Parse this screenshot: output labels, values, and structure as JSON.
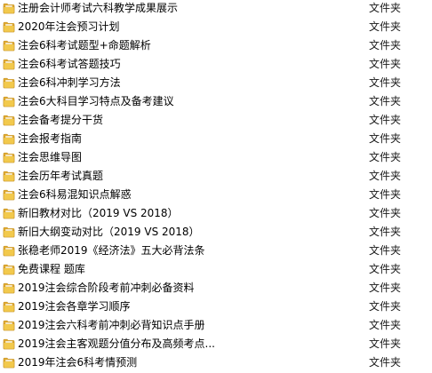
{
  "file_list": {
    "type_label": "文件夹",
    "items": [
      {
        "name": "注册会计师考试六科教学成果展示",
        "type": "文件夹"
      },
      {
        "name": "2020年注会预习计划",
        "type": "文件夹"
      },
      {
        "name": "注会6科考试题型+命题解析",
        "type": "文件夹"
      },
      {
        "name": "注会6科考试答题技巧",
        "type": "文件夹"
      },
      {
        "name": "注会6科冲刺学习方法",
        "type": "文件夹"
      },
      {
        "name": "注会6大科目学习特点及备考建议",
        "type": "文件夹"
      },
      {
        "name": "注会备考提分干货",
        "type": "文件夹"
      },
      {
        "name": "注会报考指南",
        "type": "文件夹"
      },
      {
        "name": "注会思维导图",
        "type": "文件夹"
      },
      {
        "name": "注会历年考试真题",
        "type": "文件夹"
      },
      {
        "name": "注会6科易混知识点解惑",
        "type": "文件夹"
      },
      {
        "name": "新旧教材对比（2019 VS 2018）",
        "type": "文件夹"
      },
      {
        "name": "新旧大纲变动对比（2019 VS 2018）",
        "type": "文件夹"
      },
      {
        "name": "张稳老师2019《经济法》五大必背法条",
        "type": "文件夹"
      },
      {
        "name": "免费课程 题库",
        "type": "文件夹"
      },
      {
        "name": "2019注会综合阶段考前冲刺必备资料",
        "type": "文件夹"
      },
      {
        "name": "2019注会各章学习顺序",
        "type": "文件夹"
      },
      {
        "name": "2019注会六科考前冲刺必背知识点手册",
        "type": "文件夹"
      },
      {
        "name": "2019注会主客观题分值分布及高频考点...",
        "type": "文件夹"
      },
      {
        "name": "2019年注会6科考情预测",
        "type": "文件夹"
      }
    ]
  },
  "colors": {
    "folder_body": "#f2c94c",
    "folder_back": "#e0a92e",
    "folder_edge": "#c9962a"
  }
}
